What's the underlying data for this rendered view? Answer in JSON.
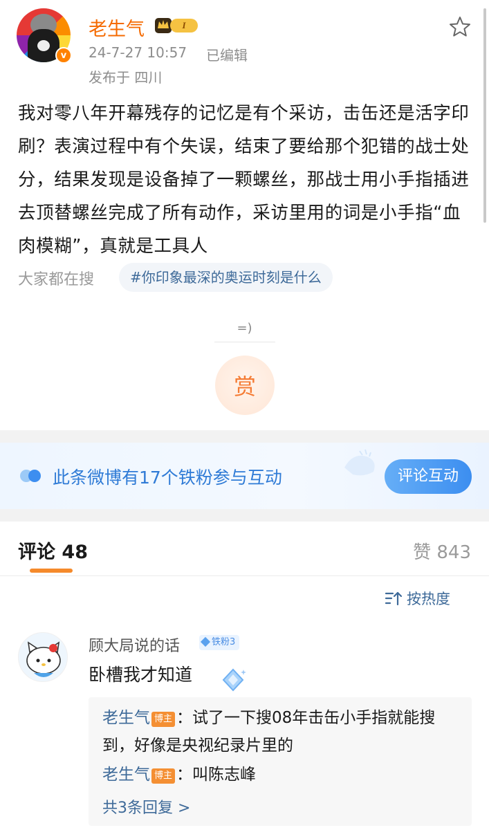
{
  "post": {
    "author": "老生气",
    "level_badge": "I",
    "time": "24-7-27 10:57",
    "edited": "已编辑",
    "location": "发布于 四川",
    "body": "我对零八年开幕残存的记忆是有个采访，击缶还是活字印刷？表演过程中有个失误，结束了要给那个犯错的战士处分，结果发现是设备掉了一颗螺丝，那战士用小手指插进去顶替螺丝完成了所有动作，采访里用的词是小手指“血肉模糊”，真就是工具人"
  },
  "search": {
    "label": "大家都在搜",
    "hashtag": "#你印象最深的奥运时刻是什么"
  },
  "reward": {
    "text": "=)",
    "button": "赏"
  },
  "fans_banner": {
    "text": "此条微博有17个铁粉参与互动",
    "button": "评论互动"
  },
  "tabs": {
    "comments_label": "评论",
    "comments_count": "48",
    "likes_label": "赞 843"
  },
  "sort": {
    "label": "按热度"
  },
  "comment": {
    "name": "顾大局说的话",
    "fan_badge": "铁粉3",
    "text": "卧槽我才知道",
    "replies": [
      {
        "author": "老生气",
        "badge": "博主",
        "text": "：试了一下搜08年击缶小手指就能搜到，好像是央视纪录片里的"
      },
      {
        "author": "老生气",
        "badge": "博主",
        "text": "：叫陈志峰"
      }
    ],
    "reply_total": "共3条回复 >"
  },
  "colors": {
    "accent_orange": "#f56a00",
    "link_blue": "#3e6a99",
    "banner_blue": "#2f7bd6"
  }
}
